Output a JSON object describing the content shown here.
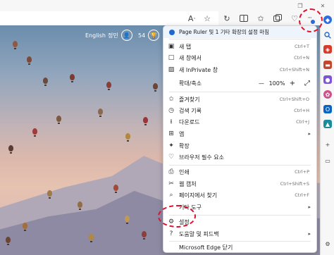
{
  "toolbar": {
    "icons": [
      "read-aloud-icon",
      "favorite-star-icon",
      "refresh-icon",
      "split-screen-icon",
      "favorites-icon",
      "collections-icon",
      "extensions-icon",
      "menu-icon"
    ],
    "read_aloud_glyph": "Aᐧ",
    "more_glyph": "···"
  },
  "content": {
    "lang_label": "English",
    "user_name": "정민",
    "points": "54"
  },
  "menu": {
    "notice": "Page Ruler 및 1 기타 확장의 설정 마침",
    "new_tab": {
      "label": "새 탭",
      "shortcut": "Ctrl+T"
    },
    "new_window": {
      "label": "새 창에서",
      "shortcut": "Ctrl+N"
    },
    "new_inprivate": {
      "label": "새 InPrivate 창",
      "shortcut": "Ctrl+Shift+N"
    },
    "zoom": {
      "label": "확대/축소",
      "minus": "—",
      "value": "100%",
      "plus": "+"
    },
    "favorites": {
      "label": "즐겨찾기",
      "shortcut": "Ctrl+Shift+O"
    },
    "history": {
      "label": "검색 기록",
      "shortcut": "Ctrl+H"
    },
    "downloads": {
      "label": "다운로드",
      "shortcut": "Ctrl+J"
    },
    "apps": {
      "label": "앱"
    },
    "extensions": {
      "label": "확장"
    },
    "browser_essentials": {
      "label": "브라우저 필수 요소"
    },
    "print": {
      "label": "인쇄",
      "shortcut": "Ctrl+P"
    },
    "web_capture": {
      "label": "웹 캡처",
      "shortcut": "Ctrl+Shift+S"
    },
    "find_on_page": {
      "label": "페이지에서 찾기",
      "shortcut": "Ctrl+F"
    },
    "more_tools": {
      "label": "기타 도구"
    },
    "settings": {
      "label": "설정"
    },
    "help_feedback": {
      "label": "도움말 및 피드백"
    },
    "close_edge": {
      "label": "Microsoft Edge 닫기"
    }
  },
  "colors": {
    "highlight_ring": "#e0102f",
    "accent": "#0067c0"
  }
}
